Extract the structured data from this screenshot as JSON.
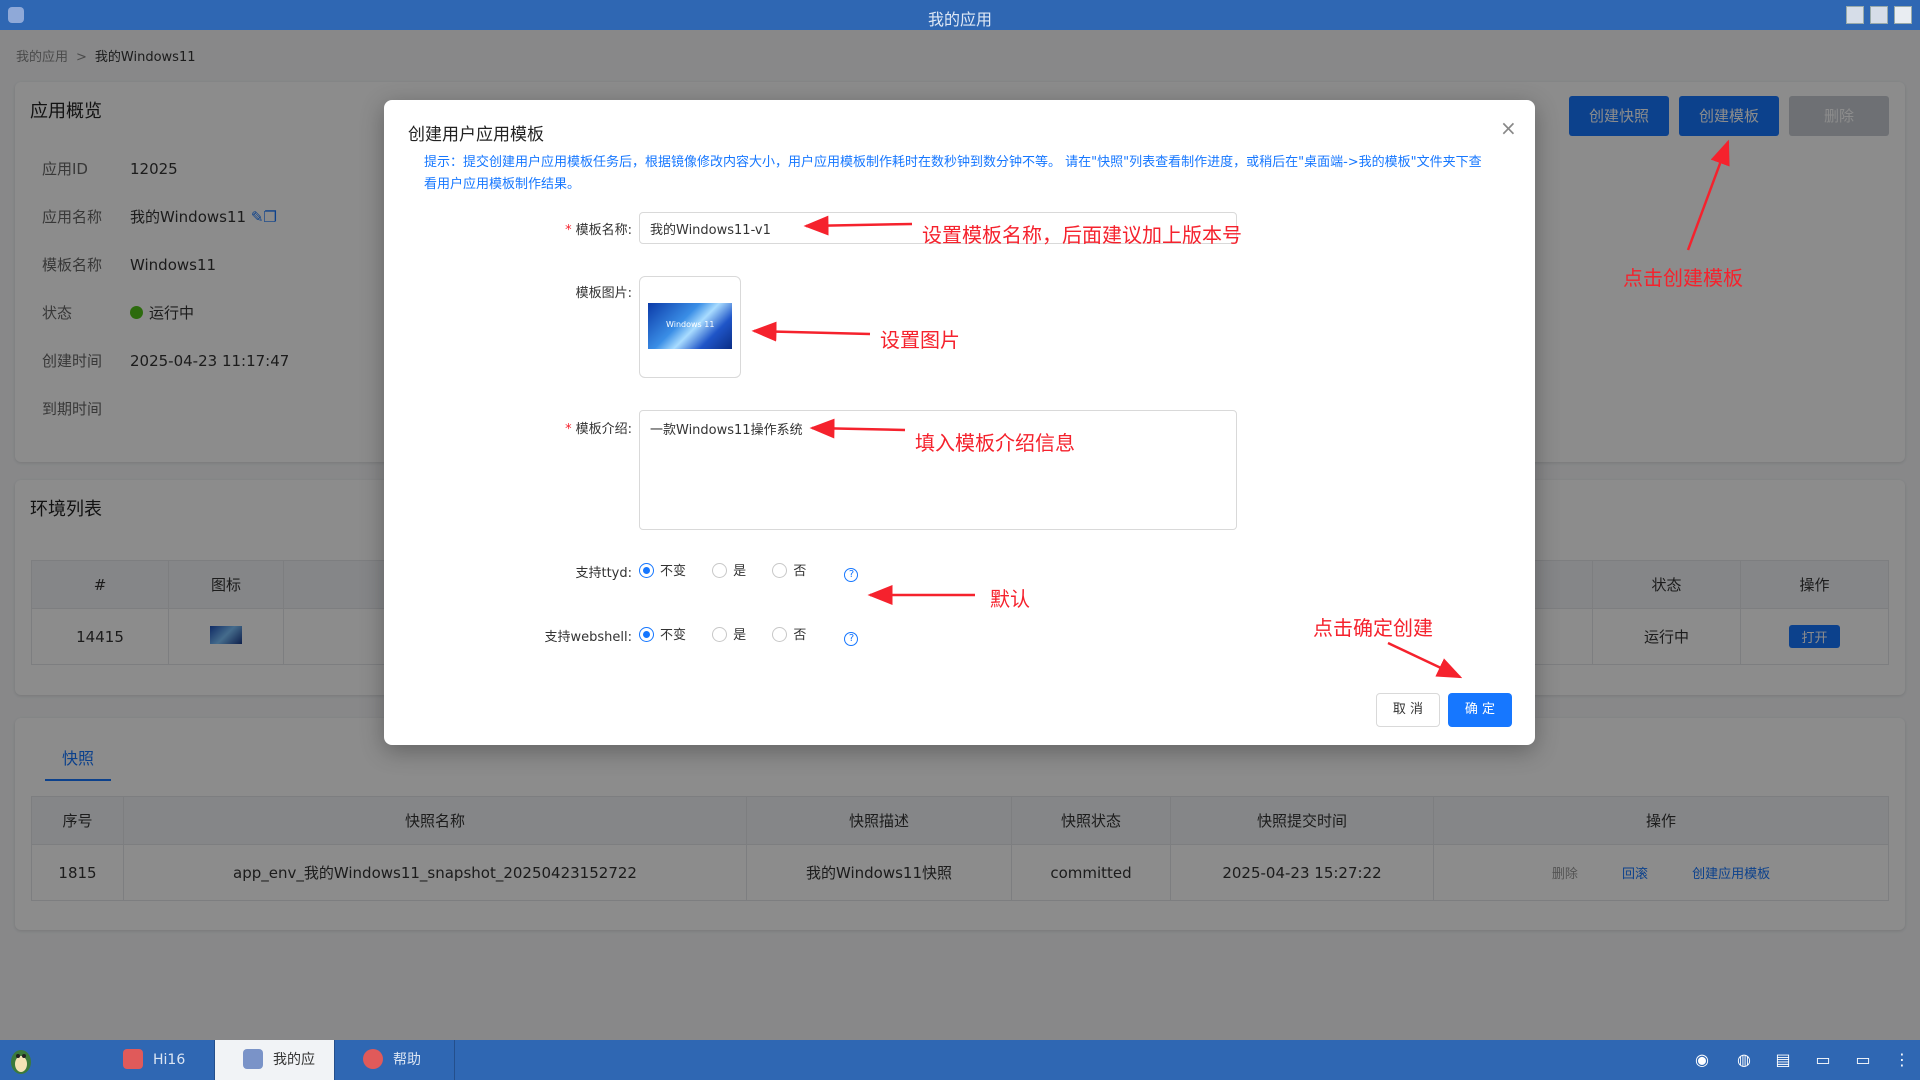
{
  "window": {
    "title": "我的应用"
  },
  "breadcrumb": {
    "root": "我的应用",
    "separator": ">",
    "current": "我的Windows11"
  },
  "overview": {
    "title": "应用概览",
    "rows": [
      {
        "label": "应用ID",
        "value": "12025"
      },
      {
        "label": "应用名称",
        "value": "我的Windows11"
      },
      {
        "label": "模板名称",
        "value": "Windows11"
      },
      {
        "label": "状态",
        "value": "运行中"
      },
      {
        "label": "创建时间",
        "value": "2025-04-23 11:17:47"
      },
      {
        "label": "到期时间",
        "value": ""
      }
    ],
    "buttons": {
      "snapshot": "创建快照",
      "template": "创建模板",
      "delete": "删除"
    }
  },
  "env": {
    "title": "环境列表",
    "headers": [
      "#",
      "图标",
      "状态",
      "操作"
    ],
    "row": {
      "id": "14415",
      "status": "运行中",
      "action": "打开"
    }
  },
  "snapshots": {
    "tab": "快照",
    "headers": [
      "序号",
      "快照名称",
      "快照描述",
      "快照状态",
      "快照提交时间",
      "操作"
    ],
    "row": {
      "id": "1815",
      "name": "app_env_我的Windows11_snapshot_20250423152722",
      "desc": "我的Windows11快照",
      "status": "committed",
      "time": "2025-04-23 15:27:22",
      "actions": [
        "删除",
        "回滚",
        "创建应用模板"
      ]
    }
  },
  "modal": {
    "title": "创建用户应用模板",
    "close": "×",
    "tip": "提示：提交创建用户应用模板任务后，根据镜像修改内容大小，用户应用模板制作耗时在数秒钟到数分钟不等。 请在\"快照\"列表查看制作进度，或稍后在\"桌面端->我的模板\"文件夹下查看用户应用模板制作结果。",
    "name_label": "模板名称:",
    "name_value": "我的Windows11-v1",
    "image_label": "模板图片:",
    "image_caption": "Windows 11",
    "intro_label": "模板介绍:",
    "intro_value": "一款Windows11操作系统",
    "ttyd_label": "支持ttyd:",
    "webshell_label": "支持webshell:",
    "options": [
      "不变",
      "是",
      "否"
    ],
    "cancel": "取 消",
    "ok": "确 定"
  },
  "annotations": {
    "name": "设置模板名称，后面建议加上版本号",
    "image": "设置图片",
    "intro": "填入模板介绍信息",
    "default": "默认",
    "confirm": "点击确定创建",
    "template": "点击创建模板"
  },
  "taskbar": {
    "items": [
      "Hi16",
      "我的应",
      "帮助"
    ]
  },
  "colors": {
    "primary": "#1677ff",
    "titlebar": "#2f67b3",
    "annotation": "#f5222d"
  }
}
